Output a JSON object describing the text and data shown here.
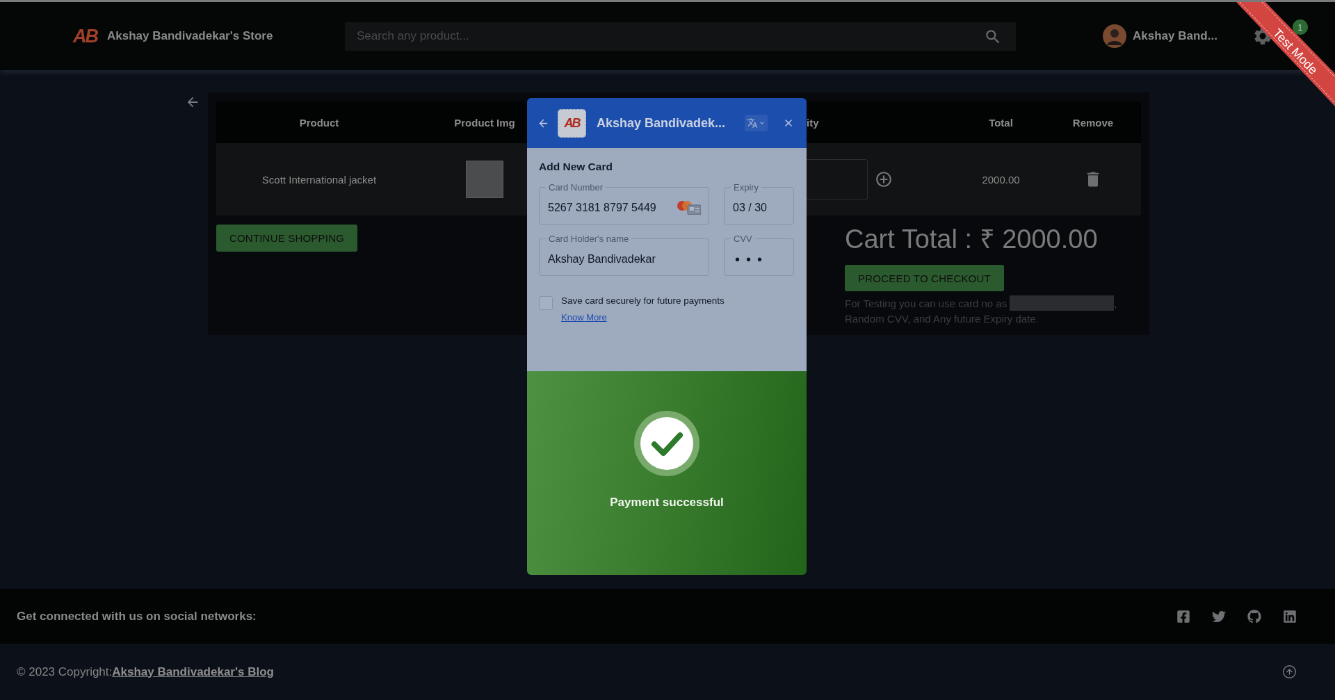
{
  "header": {
    "logo_text": "AB",
    "store_name": "Akshay Bandivadekar's Store",
    "search": {
      "placeholder": "Search any product..."
    },
    "user_name": "Akshay Band...",
    "cart_badge": "1",
    "ribbon": "Test Mode"
  },
  "cart": {
    "columns": [
      {
        "label": "Product"
      },
      {
        "label": "Product Img"
      },
      {
        "label": "ity"
      },
      {
        "label": "Total"
      },
      {
        "label": "Remove"
      }
    ],
    "rows": [
      {
        "product": "Scott International jacket",
        "total": "2000.00"
      }
    ],
    "continue_button": "CONTINUE SHOPPING",
    "cart_total": "Cart Total : ₹ 2000.00",
    "checkout_button": "PROCEED TO CHECKOUT",
    "note": {
      "lead": "For Testing you can use card no as",
      "card_number_redacted": true,
      "trail": ",",
      "second_line": "Random CVV, and Any future Expiry date."
    }
  },
  "payment_modal": {
    "logo_text": "AB",
    "title": "Akshay Bandivadek...",
    "section_title": "Add New Card",
    "fields": [
      {
        "label": "Card Number",
        "value": "5267 3181 8797 5449",
        "kind": "card"
      },
      {
        "label": "Expiry",
        "value": "03 / 30",
        "kind": "plain"
      },
      {
        "label": "Card Holder's name",
        "value": "Akshay Bandivadekar",
        "kind": "plain"
      },
      {
        "label": "CVV",
        "value": "•••",
        "kind": "masked"
      }
    ],
    "save_card": {
      "label": "Save card securely for future payments",
      "checked": false,
      "link": "Know More"
    },
    "status": {
      "kind": "success",
      "message": "Payment successful"
    }
  },
  "footer": {
    "social_heading": "Get connected with us on social networks:",
    "social_links": [
      {
        "kind": "facebook"
      },
      {
        "kind": "twitter"
      },
      {
        "kind": "github"
      },
      {
        "kind": "linkedin"
      }
    ],
    "copyright": "© 2023 Copyright:",
    "blog_link": "Akshay Bandivadekar's Blog"
  }
}
